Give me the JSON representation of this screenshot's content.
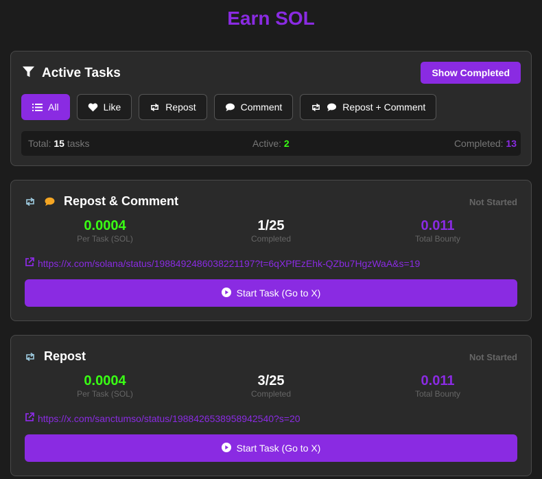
{
  "page": {
    "title": "Earn SOL"
  },
  "filters_panel": {
    "title": "Active Tasks",
    "show_completed_label": "Show Completed",
    "filters": [
      {
        "label": "All",
        "icon": "list-icon",
        "active": true
      },
      {
        "label": "Like",
        "icon": "heart-icon",
        "active": false
      },
      {
        "label": "Repost",
        "icon": "repost-icon",
        "active": false
      },
      {
        "label": "Comment",
        "icon": "comment-icon",
        "active": false
      },
      {
        "label": "Repost + Comment",
        "icons": [
          "repost-icon",
          "comment-icon"
        ],
        "active": false
      }
    ],
    "stats": {
      "total_label": "Total:",
      "total_value": "15",
      "total_suffix": "tasks",
      "active_label": "Active:",
      "active_value": "2",
      "completed_label": "Completed:",
      "completed_value": "13"
    }
  },
  "tasks": [
    {
      "title": "Repost & Comment",
      "icons": [
        "repost-icon",
        "comment-icon"
      ],
      "status": "Not Started",
      "per_task": "0.0004",
      "per_task_label": "Per Task (SOL)",
      "completed": "1/25",
      "completed_label": "Completed",
      "bounty": "0.011",
      "bounty_label": "Total Bounty",
      "link": "https://x.com/solana/status/1988492486038221197?t=6qXPfEzEhk-QZbu7HgzWaA&s=19",
      "button_label": "Start Task (Go to X)"
    },
    {
      "title": "Repost",
      "icons": [
        "repost-icon"
      ],
      "status": "Not Started",
      "per_task": "0.0004",
      "per_task_label": "Per Task (SOL)",
      "completed": "3/25",
      "completed_label": "Completed",
      "bounty": "0.011",
      "bounty_label": "Total Bounty",
      "link": "https://x.com/sanctumso/status/1988426538958942540?s=20",
      "button_label": "Start Task (Go to X)"
    }
  ],
  "colors": {
    "accent": "#8a2be2",
    "green": "#39ff14",
    "background": "#1c1c1c",
    "card": "#2a2a2a",
    "comment_orange": "#f5a623",
    "repost_blue": "#9ecbe0"
  }
}
